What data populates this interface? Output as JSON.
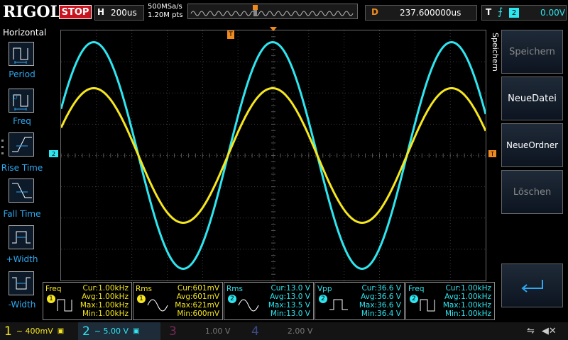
{
  "topbar": {
    "logo": "RIGOL",
    "run_state": "STOP",
    "horizontal": {
      "letter": "H",
      "value": "200us"
    },
    "sample_rate": "500MSa/s",
    "memory_depth": "1.20M pts",
    "delay": {
      "letter": "D",
      "value": "237.600000us"
    },
    "trigger": {
      "letter": "T",
      "source": "2",
      "level": "0.00V"
    }
  },
  "left_panel": {
    "title": "Horizontal",
    "buttons": [
      {
        "label": "Period"
      },
      {
        "label": "Freq"
      },
      {
        "label": "Rise Time"
      },
      {
        "label": "Fall Time"
      },
      {
        "label": "+Width"
      },
      {
        "label": "-Width"
      }
    ]
  },
  "right_panel": {
    "title": "Speichern",
    "buttons": [
      {
        "label": "Speichern",
        "enabled": false
      },
      {
        "label": "NeueDatei",
        "enabled": true
      },
      {
        "label": "NeueOrdner",
        "enabled": true
      },
      {
        "label": "Löschen",
        "enabled": false
      }
    ],
    "enter_icon": "return-arrow-icon"
  },
  "markers": {
    "ch2": "2",
    "trigger_pos": "T"
  },
  "measurements": [
    {
      "name": "Freq",
      "ch": "1",
      "cur": "Cur:1.00kHz",
      "avg": "Avg:1.00kHz",
      "max": "Max:1.00kHz",
      "min": "Min:1.00kHz"
    },
    {
      "name": "Rms",
      "ch": "1",
      "cur": "Cur:601mV",
      "avg": "Avg:601mV",
      "max": "Max:621mV",
      "min": "Min:600mV"
    },
    {
      "name": "Rms",
      "ch": "2",
      "cur": "Cur:13.0 V",
      "avg": "Avg:13.0 V",
      "max": "Max:13.5 V",
      "min": "Min:13.0 V"
    },
    {
      "name": "Vpp",
      "ch": "2",
      "cur": "Cur:36.6 V",
      "avg": "Avg:36.6 V",
      "max": "Max:36.6 V",
      "min": "Min:36.4 V"
    },
    {
      "name": "Freq",
      "ch": "2",
      "cur": "Cur:1.00kHz",
      "avg": "Avg:1.00kHz",
      "max": "Max:1.00kHz",
      "min": "Min:1.00kHz"
    }
  ],
  "channels": [
    {
      "num": "1",
      "scale": "~ 400mV",
      "color": "#f5e61e"
    },
    {
      "num": "2",
      "scale": "~ 5.00 V",
      "color": "#2ee6f0"
    },
    {
      "num": "3",
      "scale": "1.00 V",
      "color": "#c03c8c"
    },
    {
      "num": "4",
      "scale": "2.00 V",
      "color": "#2a5ad0"
    }
  ],
  "colors": {
    "ch1": "#f5e61e",
    "ch2": "#2ee6f0",
    "trigger": "#f08a1e",
    "stop": "#c8141e"
  }
}
